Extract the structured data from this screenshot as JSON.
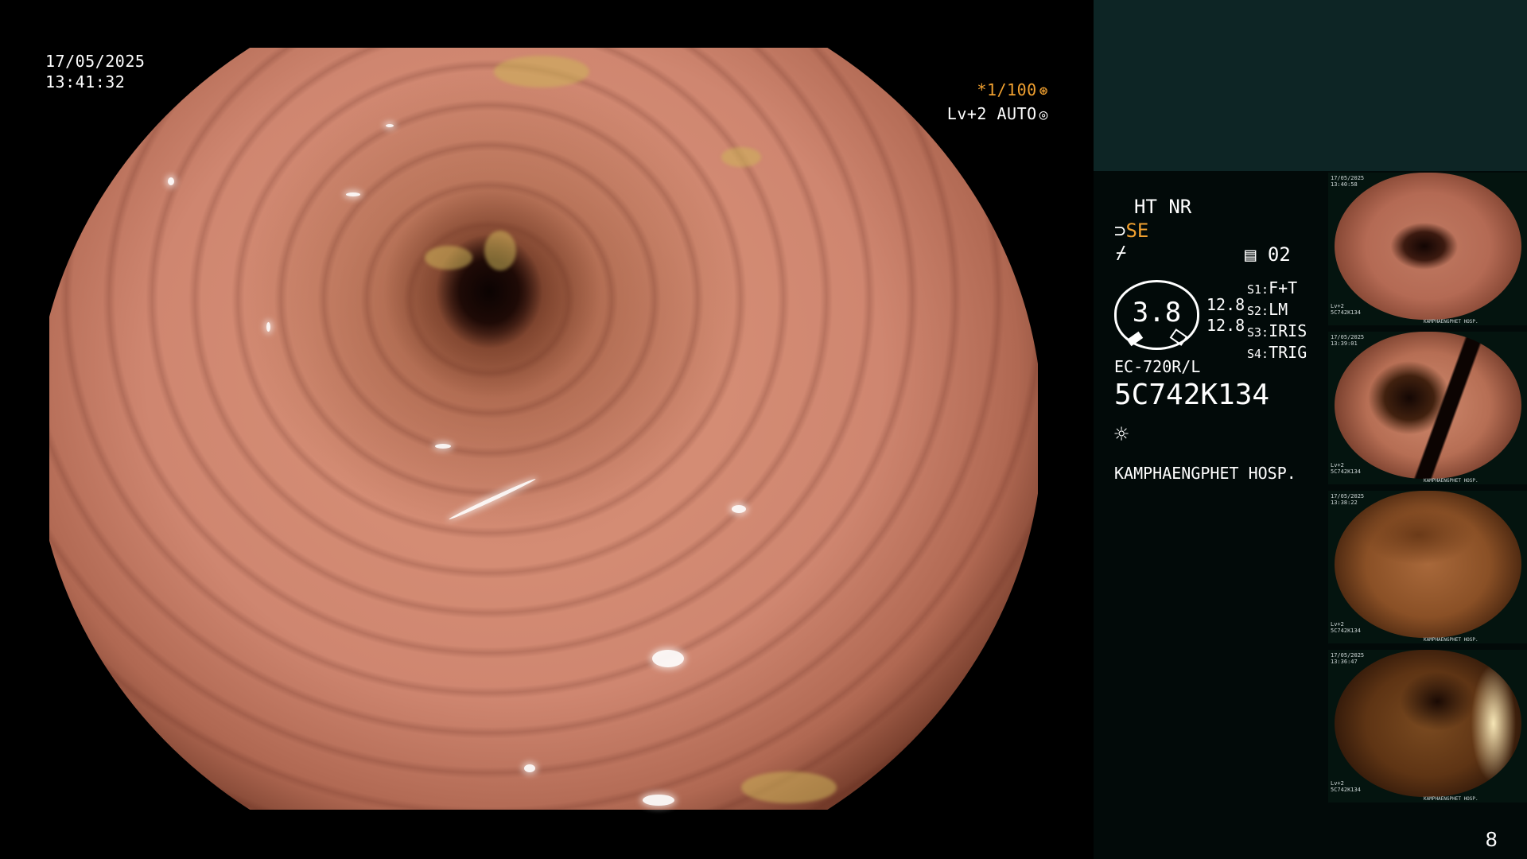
{
  "overlay": {
    "date": "17/05/2025",
    "time": "13:41:32",
    "shutter": "*1/100",
    "shutter_icon": "shutter-icon",
    "level": "Lv+2 AUTO",
    "level_icon": "iris-icon"
  },
  "panel": {
    "ht_nr": "HT NR",
    "se_label": "SE",
    "doc_value": "02",
    "gauge_value": "3.8",
    "gauge_side_1": "12.8",
    "gauge_side_2": "12.8",
    "settings": [
      {
        "key": "S1:",
        "value": "F+T"
      },
      {
        "key": "S2:",
        "value": "LM"
      },
      {
        "key": "S3:",
        "value": "IRIS"
      },
      {
        "key": "S4:",
        "value": "TRIG"
      }
    ],
    "scope_model": "EC-720R/L",
    "serial": "5C742K134",
    "hospital": "KAMPHAENGPHET HOSP."
  },
  "icons": {
    "se": "magnify-arrow-icon",
    "enhance": "enhance-icon",
    "doc": "document-icon",
    "light": "light-icon"
  },
  "thumbnails": [
    {
      "caption_top": "17/05/2025\n13:40:58",
      "caption_bottom": "Lv+2\n5C742K134",
      "footer": "KAMPHAENGPHET HOSP."
    },
    {
      "caption_top": "17/05/2025\n13:39:01",
      "caption_bottom": "Lv+2\n5C742K134",
      "footer": "KAMPHAENGPHET HOSP."
    },
    {
      "caption_top": "17/05/2025\n13:38:22",
      "caption_bottom": "Lv+2\n5C742K134",
      "footer": "KAMPHAENGPHET HOSP."
    },
    {
      "caption_top": "17/05/2025\n13:36:47",
      "caption_bottom": "Lv+2\n5C742K134",
      "footer": "KAMPHAENGPHET HOSP."
    }
  ],
  "page_number": "8"
}
